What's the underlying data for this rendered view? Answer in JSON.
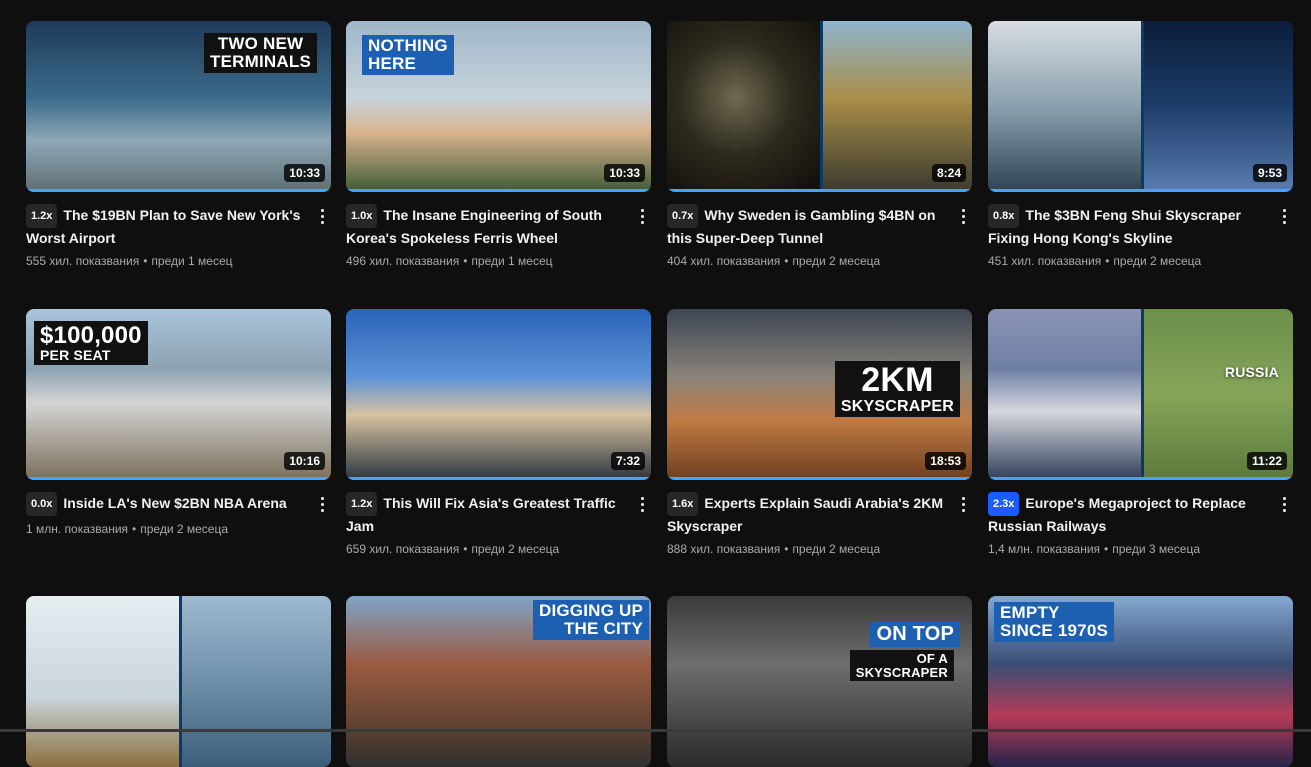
{
  "videos": [
    {
      "title": "The $19BN Plan to Save New York's Worst Airport",
      "speed": "1.2x",
      "views": "555 хил. показвания",
      "age": "преди 1 месец",
      "duration": "10:33",
      "overlay": [
        "TWO NEW",
        "TERMINALS"
      ],
      "progress": 1.0
    },
    {
      "title": "The Insane Engineering of South Korea's Spokeless Ferris Wheel",
      "speed": "1.0x",
      "views": "496 хил. показвания",
      "age": "преди 1 месец",
      "duration": "10:33",
      "overlay": [
        "NOTHING",
        "HERE"
      ],
      "progress": 1.0
    },
    {
      "title": "Why Sweden is Gambling $4BN on this Super-Deep Tunnel",
      "speed": "0.7x",
      "views": "404 хил. показвания",
      "age": "преди 2 месеца",
      "duration": "8:24",
      "overlay": [],
      "progress": 1.0
    },
    {
      "title": "The $3BN Feng Shui Skyscraper Fixing Hong Kong's Skyline",
      "speed": "0.8x",
      "views": "451 хил. показвания",
      "age": "преди 2 месеца",
      "duration": "9:53",
      "overlay": [],
      "progress": 1.0
    },
    {
      "title": "Inside LA's New $2BN NBA Arena",
      "speed": "0.0x",
      "views": "1 млн. показвания",
      "age": "преди 2 месеца",
      "duration": "10:16",
      "overlay": [
        "$100,000",
        "PER SEAT"
      ],
      "progress": 1.0
    },
    {
      "title": "This Will Fix Asia's Greatest Traffic Jam",
      "speed": "1.2x",
      "views": "659 хил. показвания",
      "age": "преди 2 месеца",
      "duration": "7:32",
      "overlay": [],
      "progress": 1.0
    },
    {
      "title": "Experts Explain Saudi Arabia's 2KM Skyscraper",
      "speed": "1.6x",
      "views": "888 хил. показвания",
      "age": "преди 2 месеца",
      "duration": "18:53",
      "overlay": [
        "2KM",
        "SKYSCRAPER"
      ],
      "progress": 1.0
    },
    {
      "title": "Europe's Megaproject to Replace Russian Railways",
      "speed": "2.3x",
      "views": "1,4 млн. показвания",
      "age": "преди 3 месеца",
      "duration": "11:22",
      "overlay": [
        "RUSSIA"
      ],
      "progress": 1.0,
      "accent": true
    },
    {
      "title": "",
      "speed": "",
      "views": "",
      "age": "",
      "duration": "",
      "overlay": [],
      "progress": 0
    },
    {
      "title": "",
      "speed": "",
      "views": "",
      "age": "",
      "duration": "",
      "overlay": [
        "DIGGING UP",
        "THE CITY"
      ],
      "progress": 0
    },
    {
      "title": "",
      "speed": "",
      "views": "",
      "age": "",
      "duration": "",
      "overlay": [
        "ON TOP",
        "OF A",
        "SKYSCRAPER"
      ],
      "progress": 0
    },
    {
      "title": "",
      "speed": "",
      "views": "",
      "age": "",
      "duration": "",
      "overlay": [
        "EMPTY",
        "SINCE 1970S"
      ],
      "progress": 0
    }
  ],
  "colors": {
    "background": "#0f0f0f",
    "progress": "#3ea6ff",
    "accent_speed": "#1a5cff"
  },
  "icons": {
    "more": "more-vert-icon"
  }
}
